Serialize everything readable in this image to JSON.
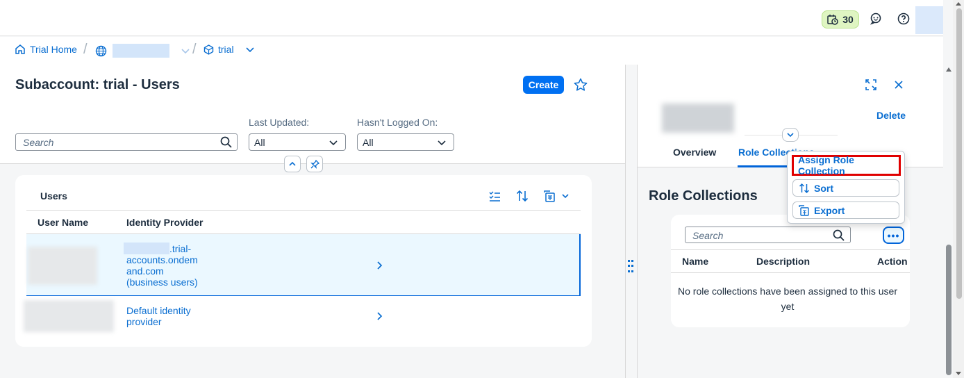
{
  "shell": {
    "trial_days": "30",
    "icons": [
      "trial-clock-icon",
      "feedback-icon",
      "help-icon"
    ]
  },
  "breadcrumb": {
    "home": "Trial Home",
    "subaccount": "trial"
  },
  "page": {
    "title": "Subaccount: trial - Users",
    "create_label": "Create",
    "search_placeholder": "Search",
    "filters": [
      {
        "label": "Last Updated:",
        "value": "All"
      },
      {
        "label": "Hasn't Logged On:",
        "value": "All"
      }
    ]
  },
  "users_table": {
    "title": "Users",
    "columns": [
      "User Name",
      "Identity Provider"
    ],
    "rows": [
      {
        "idp_line1": ".trial-",
        "idp_line2": "accounts.ondem",
        "idp_line3": "and.com",
        "idp_line4": "(business users)"
      },
      {
        "idp_line1": "Default identity",
        "idp_line2": "provider"
      }
    ]
  },
  "detail": {
    "delete_label": "Delete",
    "tabs": [
      "Overview",
      "Role Collections"
    ],
    "section_title": "Role Collections",
    "search_placeholder": "Search",
    "more_label": "•••",
    "columns": [
      "Name",
      "Description",
      "Action"
    ],
    "empty_line1": "No role collections have been assigned to this user",
    "empty_line2": "yet"
  },
  "popover": {
    "items": [
      "Assign Role Collection",
      "Sort",
      "Export"
    ]
  },
  "colors": {
    "accent": "#0070f2",
    "link": "#0a6ed1",
    "highlight": "#e00000",
    "trial_badge": "#dff5c2"
  }
}
